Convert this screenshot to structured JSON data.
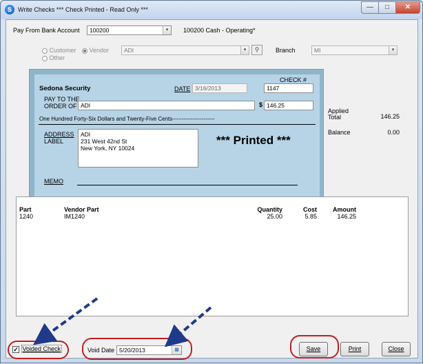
{
  "window": {
    "title": "Write Checks  *** Check Printed - Read Only ***",
    "min_glyph": "—",
    "max_glyph": "□",
    "close_glyph": "✕"
  },
  "bank": {
    "label": "Pay From Bank Account",
    "value": "100200",
    "description": "100200 Cash - Operating*"
  },
  "payee_type": {
    "customer_label": "Customer",
    "vendor_label": "Vendor",
    "other_label": "Other",
    "selected": "Vendor",
    "vendor_value": "ADI",
    "branch_label": "Branch",
    "branch_value": "MI"
  },
  "check": {
    "company": "Sedona Security",
    "date_label": "DATE",
    "date_value": "3/16/2013",
    "check_no_label": "CHECK #",
    "check_no_value": "1147",
    "pay_to_line1": "PAY TO THE",
    "pay_to_line2": "ORDER OF",
    "pay_to_value": "ADI",
    "dollar_sign": "$",
    "amount_value": "146.25",
    "amount_words": "One Hundred Forty-Six Dollars and Twenty-Five Cents-----------------------",
    "address_label_line1": "ADDRESS",
    "address_label_line2": "LABEL",
    "address_lines": [
      "ADI",
      "231 West 42nd St",
      "New York, NY  10024"
    ],
    "printed_text": "*** Printed ***",
    "memo_label": "MEMO"
  },
  "totals": {
    "applied_label_1": "Applied",
    "applied_label_2": "Total",
    "applied_value": "146.25",
    "balance_label": "Balance",
    "balance_value": "0.00"
  },
  "grid": {
    "columns": [
      "Part",
      "Vendor Part",
      "Quantity",
      "Cost",
      "Amount"
    ],
    "rows": [
      {
        "part": "1240",
        "vendor_part": "IM1240",
        "quantity": "25.00",
        "cost": "5.85",
        "amount": "146.25"
      }
    ]
  },
  "footer": {
    "voided_label": "Voided Check",
    "voided_checked": true,
    "void_date_label": "Void Date",
    "void_date_value": "5/20/2013",
    "save_label": "Save",
    "print_label": "Print",
    "close_label": "Close"
  },
  "colors": {
    "annotation_red": "#c21d1d",
    "annotation_arrow": "#1f3a8a",
    "check_bg": "#b7d4e6"
  }
}
